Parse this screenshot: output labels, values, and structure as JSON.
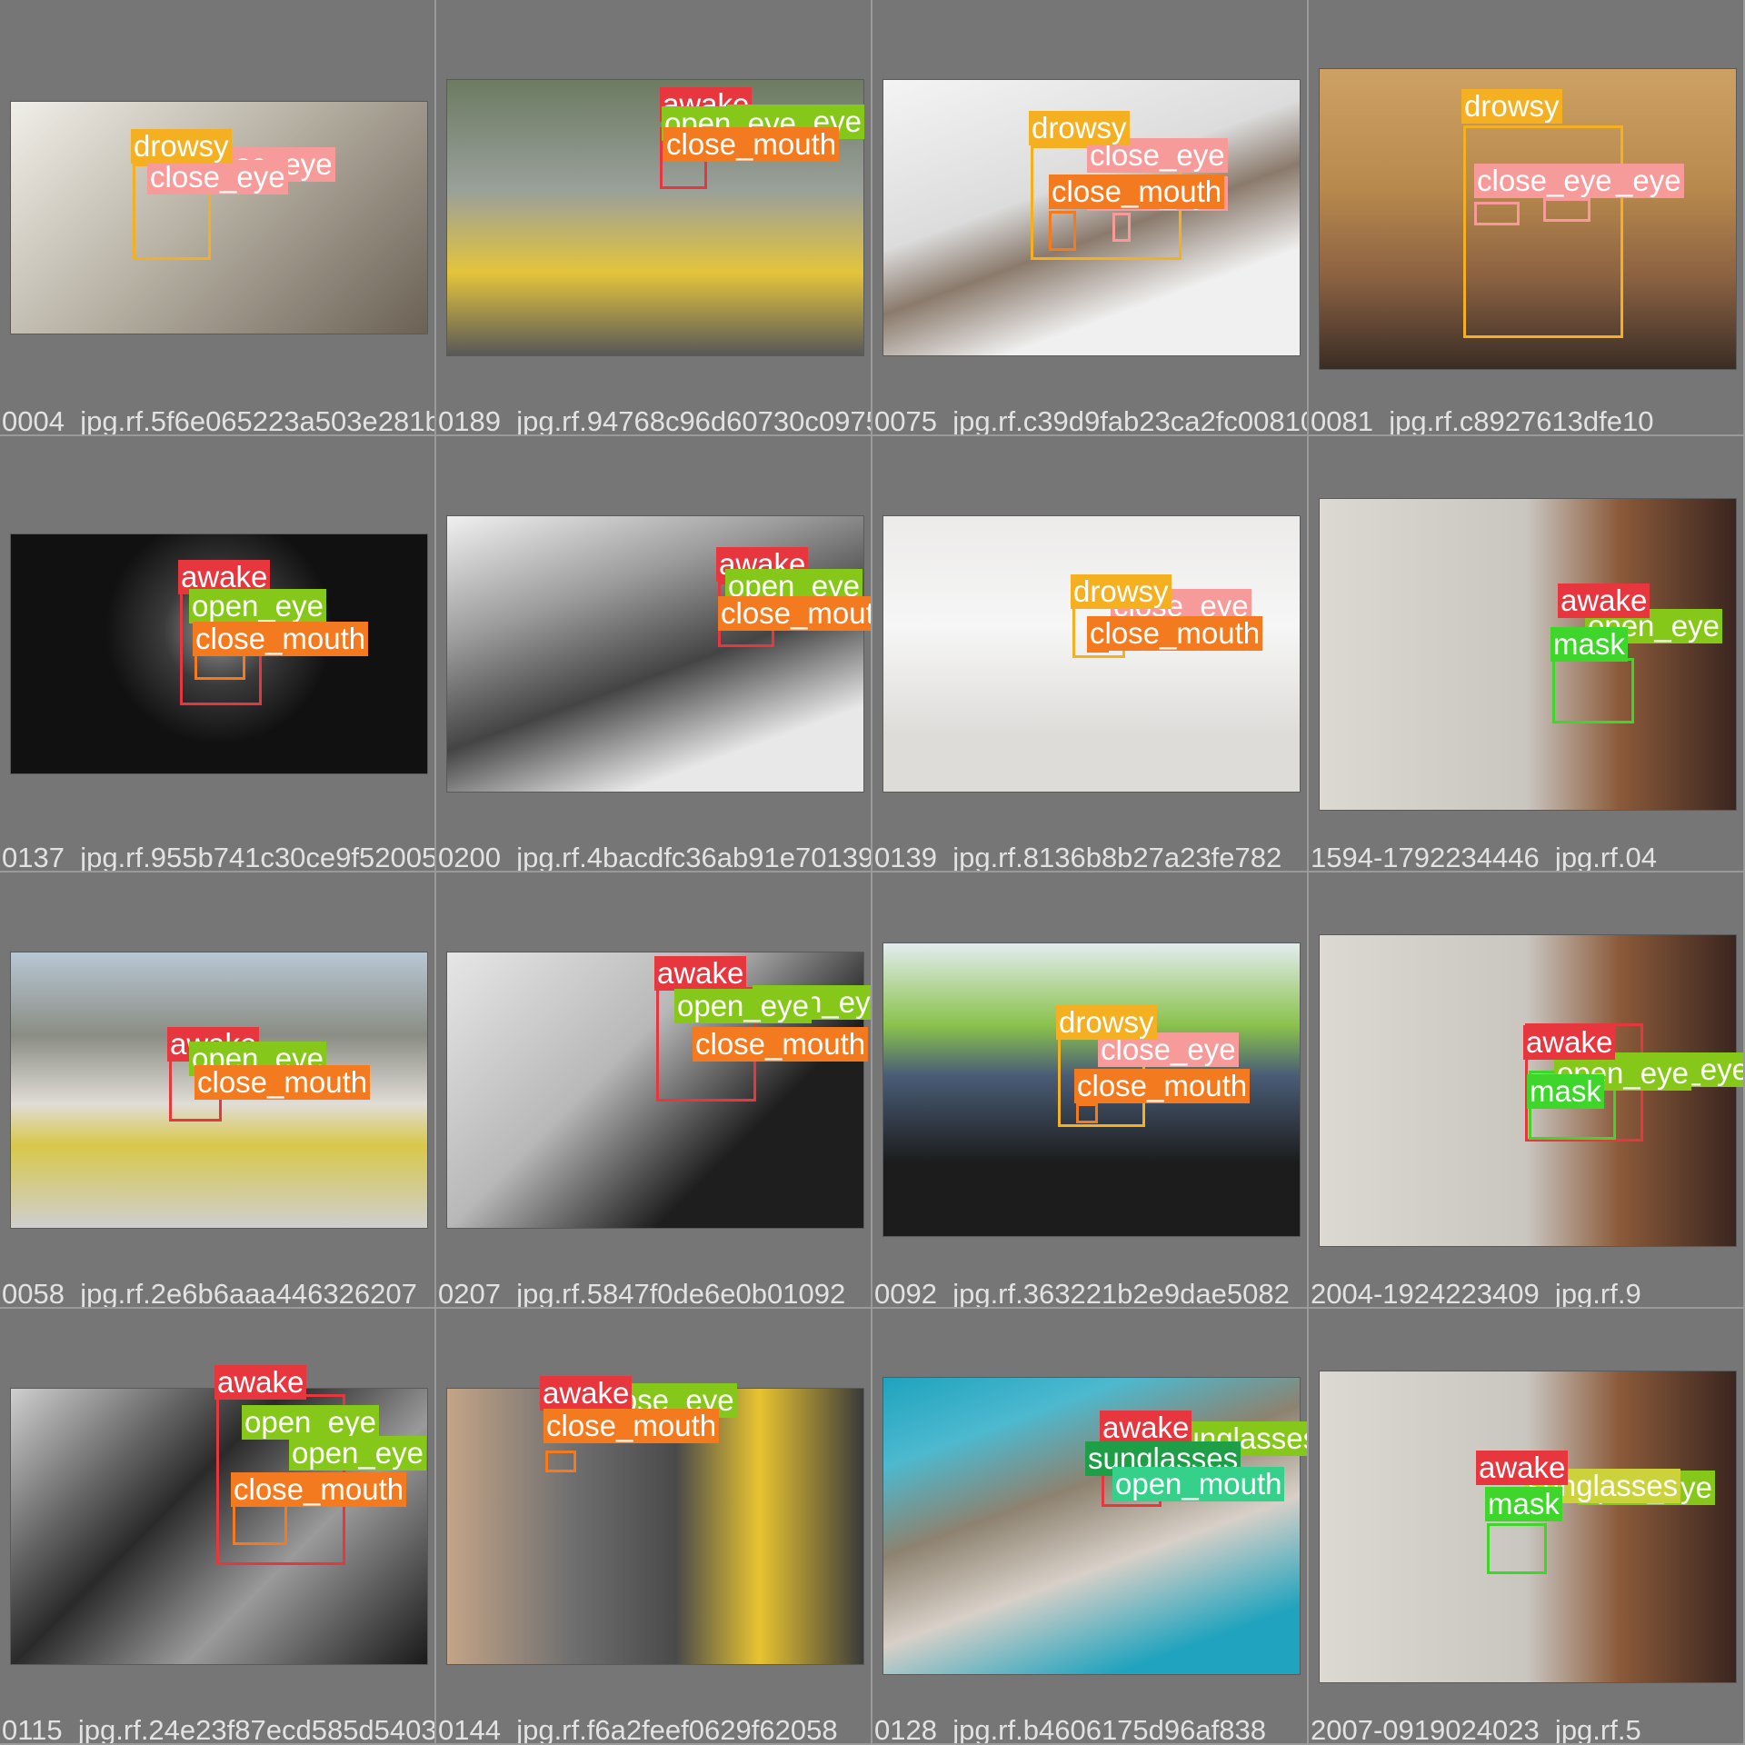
{
  "colors": {
    "drowsy": "#f5b021",
    "awake": "#e8363f",
    "open_eye": "#86c81a",
    "close_eye": "#f79a9a",
    "close_mouth": "#f47a1f",
    "mask": "#3fd62b",
    "sunglasses": "#1f9e48",
    "open_mouth": "#35d08a"
  },
  "tiles": [
    {
      "filename": "0004_jpg.rf.5f6e065223a503e281b49de84e8c96d60730",
      "scene": "#c8c4b8",
      "labels": [
        "drowsy",
        "close_eye",
        "close_eye"
      ]
    },
    {
      "filename": "0189_jpg.rf.94768c96d60730c0975",
      "scene": "#7d8a76",
      "labels": [
        "awake",
        "open_eye",
        "open_eye",
        "close_mouth"
      ]
    },
    {
      "filename": "0075_jpg.rf.c39d9fab23ca2fc00810",
      "scene": "#d9d9d9",
      "labels": [
        "drowsy",
        "close_eye",
        "close_mouth",
        "close_eye"
      ]
    },
    {
      "filename": "0081_jpg.rf.c8927613dfe10",
      "scene": "#c49a5a",
      "labels": [
        "drowsy",
        "close_eye",
        "close_eye"
      ]
    },
    {
      "filename": "0137_jpg.rf.955b741c30ce9f52005",
      "scene": "#2a2a2a",
      "labels": [
        "awake",
        "open_eye",
        "close_mouth"
      ]
    },
    {
      "filename": "0200_jpg.rf.4bacdfc36ab91e70139",
      "scene": "#b4b4b4",
      "labels": [
        "awake",
        "open_eye",
        "close_mouth"
      ]
    },
    {
      "filename": "0139_jpg.rf.8136b8b27a23fe782",
      "scene": "#e9e7e4",
      "labels": [
        "drowsy",
        "close_eye",
        "close_mouth"
      ]
    },
    {
      "filename": "1594-1792234446_jpg.rf.04",
      "scene": "#4a3d37",
      "labels": [
        "awake",
        "open_eye",
        "mask"
      ]
    },
    {
      "filename": "0058_jpg.rf.2e6b6aaa446326207",
      "scene": "#9cadba",
      "labels": [
        "awake",
        "open_eye",
        "close_mouth"
      ]
    },
    {
      "filename": "0207_jpg.rf.5847f0de6e0b01092",
      "scene": "#8a8a8a",
      "labels": [
        "awake",
        "open_eye",
        "open_eye",
        "close_mouth"
      ]
    },
    {
      "filename": "0092_jpg.rf.363221b2e9dae5082",
      "scene": "#4a5a6a",
      "labels": [
        "drowsy",
        "close_eye",
        "close_mouth"
      ]
    },
    {
      "filename": "2004-1924223409_jpg.rf.9",
      "scene": "#4a3d37",
      "labels": [
        "awake",
        "open_eye",
        "open_eye",
        "mask"
      ]
    },
    {
      "filename": "0115_jpg.rf.24e23f87ecd585d5403",
      "scene": "#6a6a6a",
      "labels": [
        "awake",
        "open_eye",
        "open_eye",
        "close_mouth"
      ]
    },
    {
      "filename": "0144_jpg.rf.f6a2feef0629f62058",
      "scene": "#8a6a52",
      "labels": [
        "awake",
        "close_eye",
        "close_mouth"
      ]
    },
    {
      "filename": "0128_jpg.rf.b4606175d96af838",
      "scene": "#2fa9c4",
      "labels": [
        "awake",
        "sunglasses",
        "sunglasses",
        "open_mouth"
      ]
    },
    {
      "filename": "2007-0919024023_jpg.rf.5",
      "scene": "#4a3d37",
      "labels": [
        "awake",
        "sunglasses",
        "open_eye",
        "mask"
      ]
    }
  ]
}
